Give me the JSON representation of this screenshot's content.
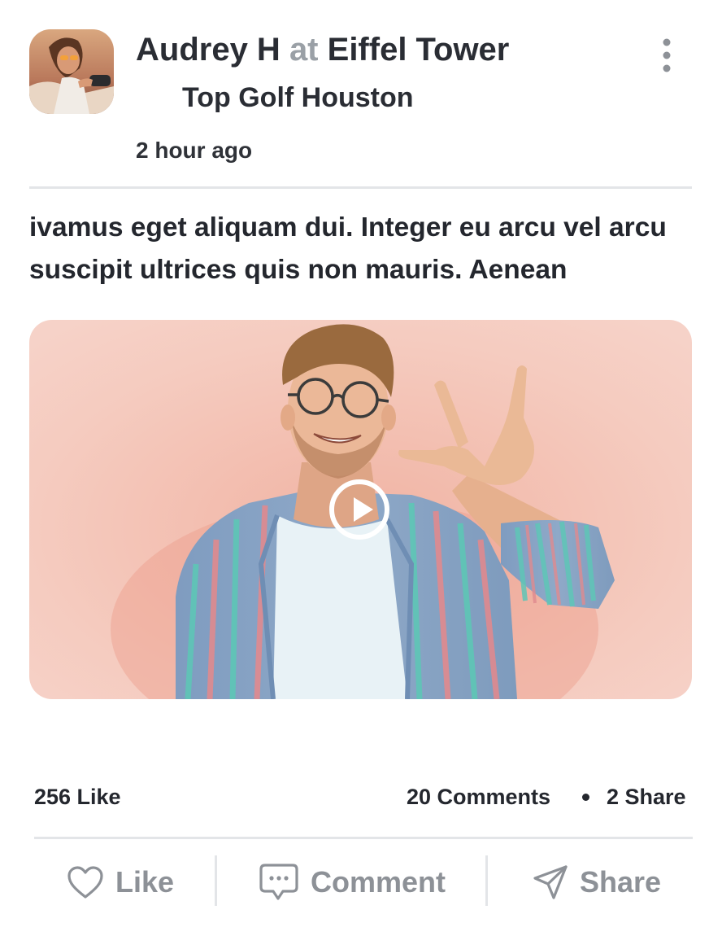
{
  "post": {
    "author": "Audrey H",
    "connector": "at",
    "location": "Eiffel Tower",
    "sublocation": "Top Golf Houston",
    "time": "2 hour ago",
    "text": "ivamus eget aliquam dui. Integer eu arcu vel arcu suscipit ultrices quis non mauris. Aenean"
  },
  "icons": {
    "more": "more-vertical-icon",
    "play": "play-circle-icon",
    "like": "heart-icon",
    "comment": "chat-bubble-icon",
    "share": "send-icon"
  },
  "stats": {
    "likes": "256 Like",
    "comments": "20 Comments",
    "shares": "2 Share"
  },
  "actions": {
    "like": "Like",
    "comment": "Comment",
    "share": "Share"
  },
  "colors": {
    "text": "#24272e",
    "muted": "#8d9197",
    "connector": "#9aa0a6",
    "divider": "#e3e5e8",
    "media_background": "#f4c9bd"
  }
}
